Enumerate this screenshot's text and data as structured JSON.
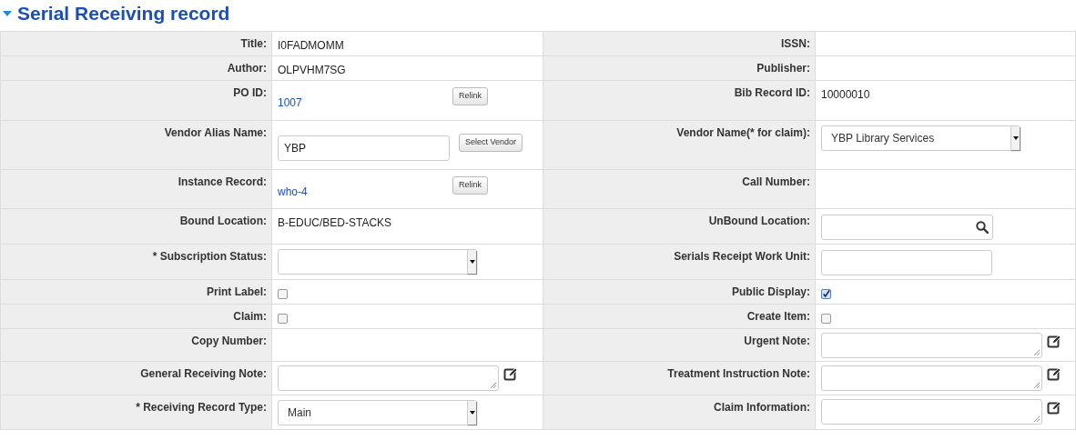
{
  "section": {
    "title": "Serial Receiving record",
    "expanded": true
  },
  "rows": [
    {
      "left": {
        "label": "Title:",
        "kind": "text",
        "value": "I0FADMOMM"
      },
      "right": {
        "label": "ISSN:",
        "kind": "empty"
      }
    },
    {
      "left": {
        "label": "Author:",
        "kind": "text",
        "value": "OLPVHM7SG"
      },
      "right": {
        "label": "Publisher:",
        "kind": "empty"
      }
    },
    {
      "left": {
        "label": "PO ID:",
        "kind": "link",
        "value": "1007",
        "button": "Relink"
      },
      "right": {
        "label": "Bib Record ID:",
        "kind": "text",
        "value": "10000010"
      }
    },
    {
      "left": {
        "label": "Vendor Alias Name:",
        "kind": "input",
        "value": "YBP",
        "button": "Select Vendor"
      },
      "right": {
        "label": "Vendor Name(* for claim):",
        "kind": "select",
        "value": "YBP Library Services"
      }
    },
    {
      "left": {
        "label": "Instance Record:",
        "kind": "link",
        "value": "who-4",
        "button": "Relink"
      },
      "right": {
        "label": "Call Number:",
        "kind": "empty"
      }
    },
    {
      "left": {
        "label": "Bound Location:",
        "kind": "text",
        "value": "B-EDUC/BED-STACKS"
      },
      "right": {
        "label": "UnBound Location:",
        "kind": "lookup"
      }
    },
    {
      "left": {
        "label": "* Subscription Status:",
        "kind": "select"
      },
      "right": {
        "label": "Serials Receipt Work Unit:",
        "kind": "input"
      }
    },
    {
      "left": {
        "label": "Print Label:",
        "kind": "checkbox",
        "checked": false
      },
      "right": {
        "label": "Public Display:",
        "kind": "checkbox",
        "checked": true
      }
    },
    {
      "left": {
        "label": "Claim:",
        "kind": "checkbox",
        "checked": false
      },
      "right": {
        "label": "Create Item:",
        "kind": "checkbox",
        "checked": false
      }
    },
    {
      "left": {
        "label": "Copy Number:",
        "kind": "empty"
      },
      "right": {
        "label": "Urgent Note:",
        "kind": "note"
      }
    },
    {
      "left": {
        "label": "General Receiving Note:",
        "kind": "note"
      },
      "right": {
        "label": "Treatment Instruction Note:",
        "kind": "note"
      }
    },
    {
      "left": {
        "label": "* Receiving Record Type:",
        "kind": "select",
        "value": "Main"
      },
      "right": {
        "label": "Claim Information:",
        "kind": "note"
      }
    }
  ]
}
